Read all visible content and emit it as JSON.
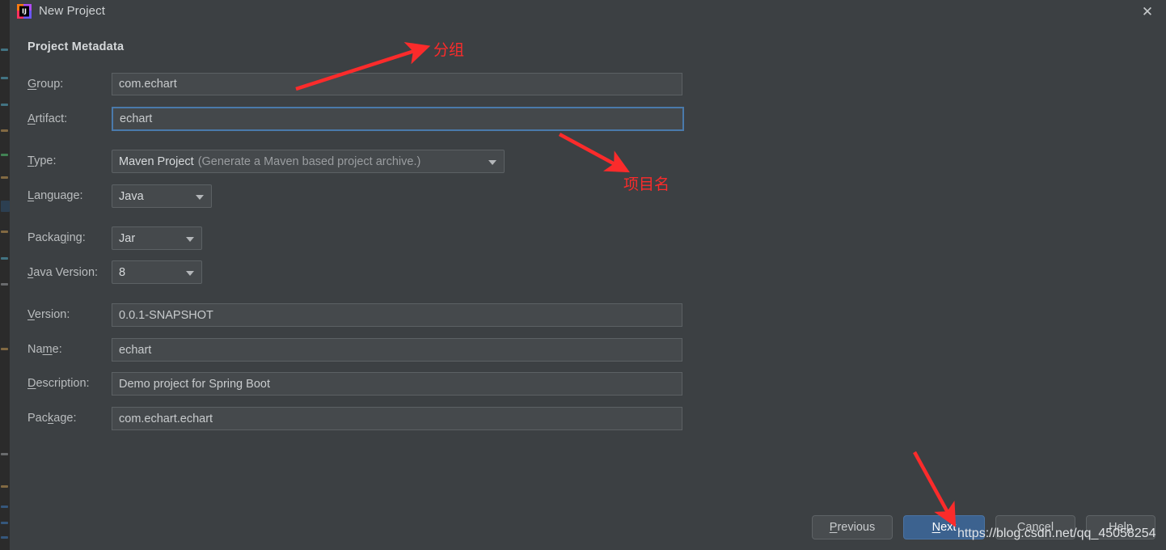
{
  "window": {
    "title": "New Project",
    "app_icon": "intellij-idea-icon",
    "close_icon": "close-icon"
  },
  "form": {
    "heading": "Project Metadata",
    "fields": [
      {
        "label": "Group:",
        "mnemonic": "G",
        "value": "com.echart",
        "kind": "text",
        "focused": false
      },
      {
        "label": "Artifact:",
        "mnemonic": "A",
        "value": "echart",
        "kind": "text",
        "focused": true
      },
      {
        "label": "Type:",
        "mnemonic": "T",
        "value": "Maven Project",
        "hint": "(Generate a Maven based project archive.)",
        "kind": "combo"
      },
      {
        "label": "Language:",
        "mnemonic": "L",
        "value": "Java",
        "kind": "combo"
      },
      {
        "label": "Packaging:",
        "mnemonic": "g",
        "value": "Jar",
        "kind": "combo"
      },
      {
        "label": "Java Version:",
        "mnemonic": "J",
        "value": "8",
        "kind": "combo"
      },
      {
        "label": "Version:",
        "mnemonic": "V",
        "value": "0.0.1-SNAPSHOT",
        "kind": "text",
        "focused": false
      },
      {
        "label": "Name:",
        "mnemonic": "m",
        "value": "echart",
        "kind": "text",
        "focused": false
      },
      {
        "label": "Description:",
        "mnemonic": "D",
        "value": "Demo project for Spring Boot",
        "kind": "text",
        "focused": false
      },
      {
        "label": "Package:",
        "mnemonic": "k",
        "value": "com.echart.echart",
        "kind": "text",
        "focused": false
      }
    ]
  },
  "buttons": {
    "previous": "Previous",
    "next": "Next",
    "cancel": "Cancel",
    "help": "Help"
  },
  "annotations": [
    {
      "text": "分组",
      "name": "annotation-group"
    },
    {
      "text": "项目名",
      "name": "annotation-project-name"
    }
  ],
  "watermark": "https://blog.csdn.net/qq_45058254",
  "colors": {
    "dialog_bg": "#3c4043",
    "field_bg": "#45494c",
    "field_border": "#5c6164",
    "focus_border": "#4a7aab",
    "primary_button": "#3c628f",
    "annotation_red": "#fb2b2b",
    "text": "#c8cbcd"
  }
}
